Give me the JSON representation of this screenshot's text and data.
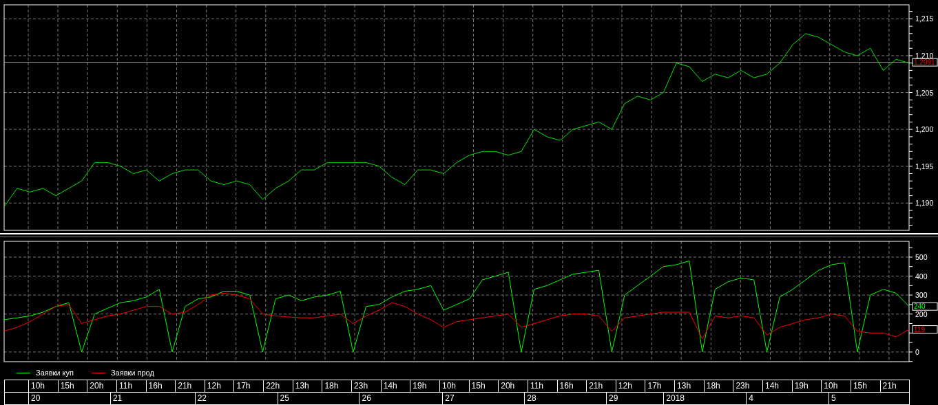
{
  "price_chart": {
    "chart_data": {
      "type": "line",
      "categories": [
        null,
        null,
        null,
        null,
        null,
        null,
        null,
        null,
        null,
        null,
        null,
        null,
        null,
        null,
        null,
        null,
        null,
        null,
        null,
        null,
        null,
        null,
        null,
        null,
        null,
        null,
        null,
        null,
        null,
        null,
        null,
        null,
        null,
        null,
        null,
        null,
        null,
        null,
        null,
        null,
        null,
        null,
        null,
        null,
        null,
        null,
        null,
        null,
        null,
        null,
        null,
        null,
        null,
        null,
        null,
        null,
        null,
        null,
        null,
        null,
        null,
        null,
        null,
        null,
        null,
        null,
        null,
        null,
        null,
        null,
        null
      ],
      "ylim": [
        1186.3,
        1216.9
      ],
      "yticks": [
        {
          "value": 1190,
          "label": "1,190"
        },
        {
          "value": 1195,
          "label": "1,195"
        },
        {
          "value": 1200,
          "label": "1,200"
        },
        {
          "value": 1205,
          "label": "1,205"
        },
        {
          "value": 1210,
          "label": "1,210"
        },
        {
          "value": 1215,
          "label": "1,215"
        }
      ],
      "grid": true,
      "ref_lines": [
        {
          "axis": "y",
          "value": 1209.1
        }
      ],
      "series": [
        {
          "color": "#00e600",
          "values": [
            1189.5,
            1192,
            1191.5,
            1192,
            1191,
            1192,
            1193,
            1195.5,
            1195.5,
            1195,
            1194,
            1194.5,
            1193,
            1194,
            1194.5,
            1194.5,
            1193,
            1192.5,
            1193,
            1192.5,
            1190.5,
            1192,
            1193,
            1194.5,
            1194.5,
            1195.5,
            1195.5,
            1195.5,
            1195.5,
            1195,
            1193.5,
            1192.5,
            1194.5,
            1194.5,
            1194,
            1195.5,
            1196.5,
            1197,
            1197,
            1196.5,
            1197,
            1200,
            1199,
            1198.5,
            1200,
            1200.5,
            1201,
            1200,
            1203.5,
            1204.5,
            1204,
            1205,
            1209,
            1208.5,
            1206.5,
            1207.5,
            1207,
            1208,
            1207,
            1207.5,
            1209,
            1211.5,
            1213,
            1212.5,
            1211.5,
            1210.5,
            1210,
            1211,
            1208,
            1209.5,
            1209
          ]
        }
      ]
    },
    "last_value": "1,2091"
  },
  "orders_chart": {
    "chart_data": {
      "type": "line",
      "categories": [
        null,
        null,
        null,
        null,
        null,
        null,
        null,
        null,
        null,
        null,
        null,
        null,
        null,
        null,
        null,
        null,
        null,
        null,
        null,
        null,
        null,
        null,
        null,
        null,
        null,
        null,
        null,
        null,
        null,
        null,
        null,
        null,
        null,
        null,
        null,
        null,
        null,
        null,
        null,
        null,
        null,
        null,
        null,
        null,
        null,
        null,
        null,
        null,
        null,
        null,
        null,
        null,
        null,
        null,
        null,
        null,
        null,
        null,
        null,
        null,
        null,
        null,
        null,
        null,
        null,
        null,
        null,
        null,
        null,
        null,
        null
      ],
      "ylim": [
        -51,
        583
      ],
      "yticks": [
        0,
        200,
        300,
        400,
        500
      ],
      "grid": true,
      "series": [
        {
          "name": "Заявки куп",
          "color": "#00ff00",
          "values": [
            170,
            180,
            190,
            210,
            240,
            260,
            0,
            200,
            230,
            260,
            270,
            290,
            330,
            0,
            240,
            280,
            290,
            320,
            320,
            300,
            0,
            280,
            300,
            270,
            290,
            300,
            320,
            0,
            240,
            250,
            290,
            320,
            330,
            350,
            220,
            250,
            280,
            380,
            400,
            420,
            0,
            330,
            350,
            380,
            410,
            420,
            430,
            0,
            300,
            350,
            400,
            450,
            460,
            480,
            0,
            330,
            370,
            390,
            380,
            0,
            290,
            330,
            380,
            430,
            460,
            470,
            0,
            300,
            330,
            310,
            240
          ]
        },
        {
          "name": "Заявки прод",
          "color": "#ff0000",
          "values": [
            110,
            130,
            160,
            200,
            240,
            250,
            150,
            170,
            190,
            200,
            220,
            240,
            240,
            200,
            210,
            250,
            300,
            310,
            300,
            280,
            200,
            190,
            185,
            180,
            180,
            190,
            200,
            150,
            190,
            220,
            260,
            240,
            200,
            170,
            130,
            160,
            170,
            180,
            190,
            200,
            130,
            150,
            170,
            190,
            200,
            200,
            190,
            110,
            180,
            190,
            200,
            210,
            210,
            210,
            70,
            190,
            180,
            190,
            180,
            90,
            130,
            150,
            170,
            180,
            200,
            190,
            110,
            100,
            100,
            80,
            119
          ]
        }
      ]
    },
    "last_values": [
      "240",
      "119"
    ]
  },
  "time_axis": {
    "hours": [
      "10h",
      "15h",
      "20h",
      "11h",
      "16h",
      "21h",
      "12h",
      "17h",
      "22h",
      "13h",
      "18h",
      "23h",
      "14h",
      "19h",
      "10h",
      "15h",
      "20h",
      "11h",
      "16h",
      "21h",
      "12h",
      "17h",
      "13h",
      "18h",
      "23h",
      "14h",
      "19h",
      "10h",
      "15h",
      "21h"
    ],
    "dates": [
      "20",
      "21",
      "22",
      "25",
      "26",
      "27",
      "28",
      "29",
      "2018",
      "4",
      "5"
    ]
  }
}
